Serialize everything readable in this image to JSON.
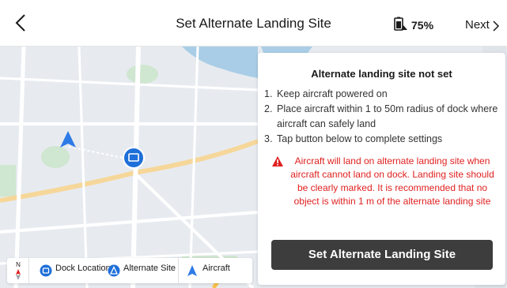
{
  "header": {
    "title": "Set Alternate Landing Site",
    "battery": "75%",
    "next_label": "Next"
  },
  "panel": {
    "title": "Alternate landing site not set",
    "steps": [
      {
        "num": "1.",
        "text": "Keep aircraft powered on"
      },
      {
        "num": "2.",
        "text": "Place aircraft within 1 to 50m radius of dock where aircraft can safely land"
      },
      {
        "num": "3.",
        "text": "Tap button below to complete settings"
      }
    ],
    "warning": "Aircraft will land on alternate landing site when aircraft cannot land on dock. Landing site should be clearly marked. It is recommended that no object is within 1 m of the alternate landing site",
    "button_label": "Set Alternate Landing Site"
  },
  "legend": {
    "compass_label": "N",
    "dock": "Dock Location",
    "alternate": "Alternate Site",
    "aircraft": "Aircraft"
  },
  "colors": {
    "accent": "#1e6fd9",
    "warning": "#e02020",
    "button": "#3d3d3d"
  }
}
